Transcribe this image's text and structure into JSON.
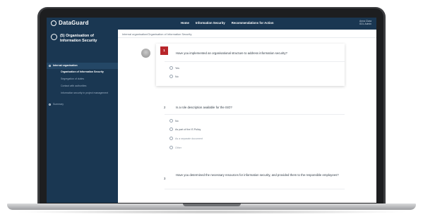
{
  "app": {
    "logo": "DataGuard",
    "nav": [
      "Home",
      "Information Security",
      "Recommendations for Action"
    ],
    "user": {
      "name": "Anna Clara",
      "sub": "GDL Admin"
    }
  },
  "sidebar": {
    "title": "(5) Organisation of Information Security",
    "group": "Internal organisation",
    "items": [
      "Organisation of Information Security",
      "Segregation of duties",
      "Contact with authorities",
      "Information security in project management"
    ],
    "summary": "Summary"
  },
  "breadcrumb": "Internal organisation/Organisation of Information Security",
  "questions": [
    {
      "number": "1",
      "text": "Have you implemented an organisational structure to address information security?",
      "options": [
        "Yes",
        "No"
      ]
    },
    {
      "number": "2",
      "text": "Is a role description available for the ISO?",
      "options": [
        "No",
        "As part of the IS Policy",
        "As a separate document",
        "Other"
      ]
    },
    {
      "number": "3",
      "text": "Have you determined the necessary resources for information security, and provided them to the responsible employees?"
    }
  ],
  "colors": {
    "navy": "#1a3752",
    "accent": "#b8262b"
  }
}
